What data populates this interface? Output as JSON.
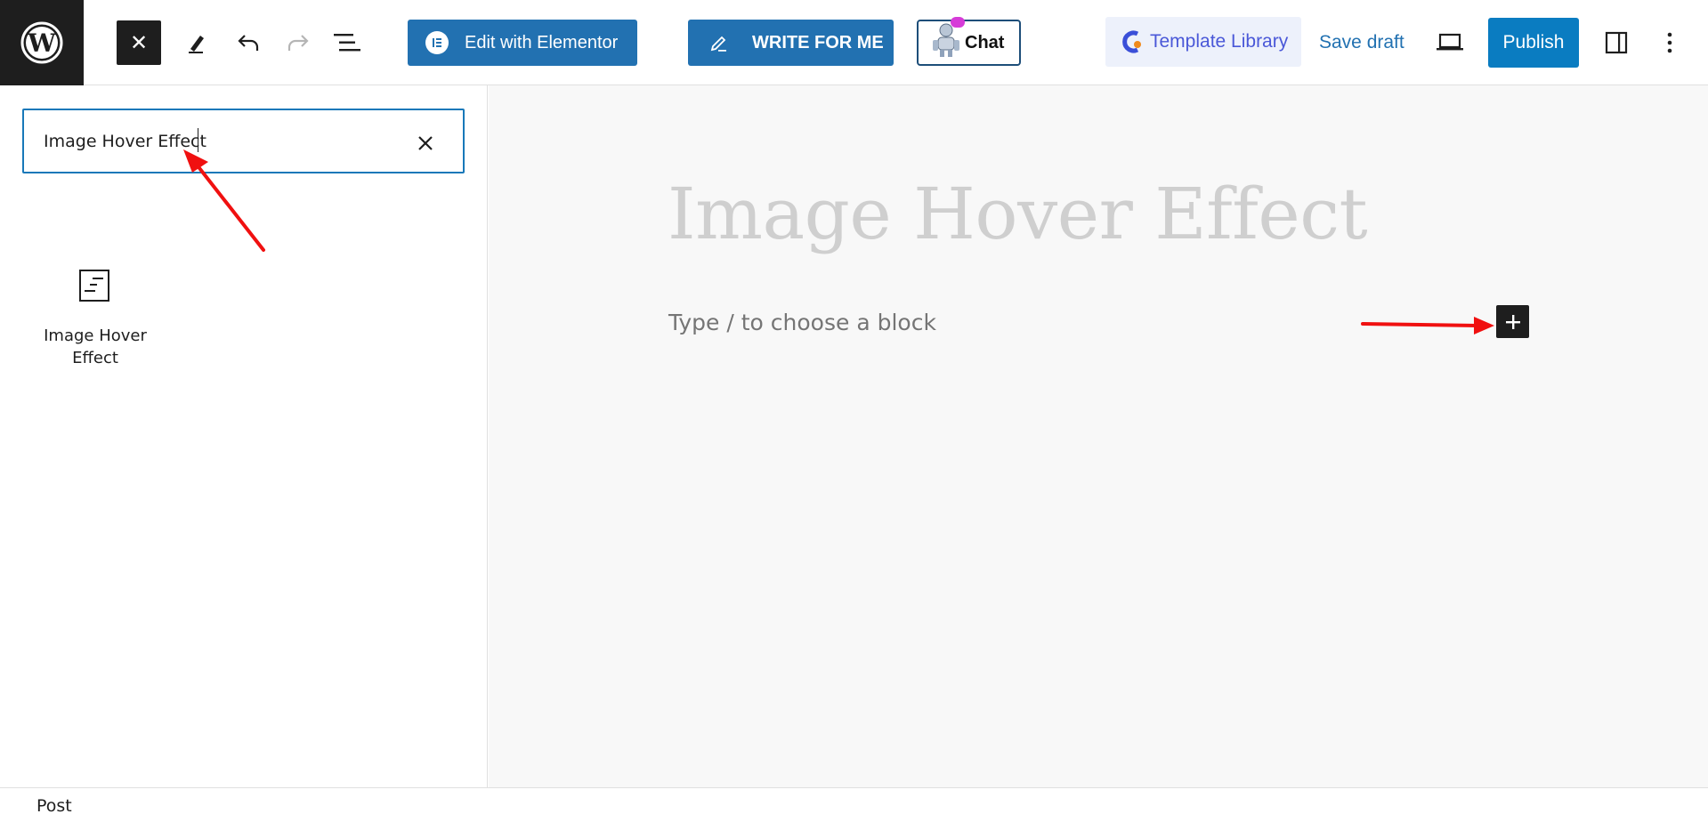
{
  "toolbar": {
    "close_label": "✕",
    "elementor_label": "Edit with Elementor",
    "write_label": "WRITE FOR ME",
    "chat_label": "Chat",
    "template_label": "Template Library",
    "save_draft_label": "Save draft",
    "publish_label": "Publish"
  },
  "inserter": {
    "search_value": "Image Hover Effect",
    "results": [
      {
        "label": "Image Hover Effect",
        "icon": "block-text-icon"
      }
    ]
  },
  "canvas": {
    "title": "Image Hover Effect",
    "block_placeholder": "Type / to choose a block"
  },
  "footer": {
    "breadcrumb": "Post"
  },
  "colors": {
    "accent": "#2271b1",
    "publish": "#0a7cc1",
    "dark": "#1e1e1e",
    "annotation_arrow": "#f01010"
  }
}
